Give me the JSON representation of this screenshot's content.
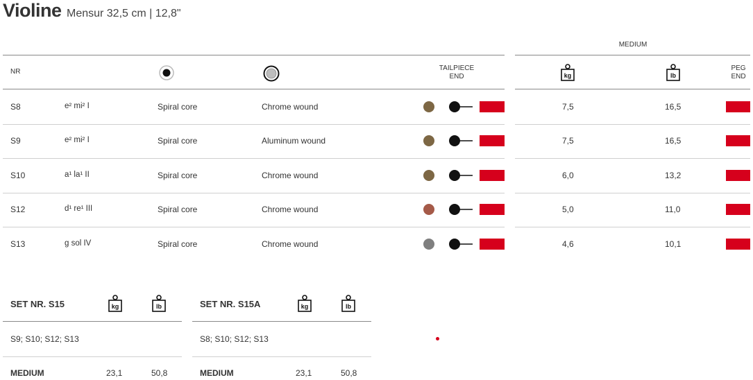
{
  "title": {
    "name": "Violine",
    "subtitle": "Mensur 32,5 cm | 12,8\""
  },
  "table": {
    "col_nr": "NR",
    "col_tailpiece": "TAILPIECE END",
    "col_tension_group": "MEDIUM",
    "col_kg": "kg",
    "col_lb": "lb",
    "col_peg": "PEG END",
    "icons": {
      "core": "core-icon",
      "wrapping": "wrapping-icon",
      "weight": "weight-icon"
    },
    "rows": [
      {
        "nr": "S8",
        "note": "e² mi² I",
        "core": "Spiral core",
        "wound": "Chrome wound",
        "silk": "#7d6744",
        "kg": "7,5",
        "lb": "16,5"
      },
      {
        "nr": "S9",
        "note": "e² mi² I",
        "core": "Spiral core",
        "wound": "Aluminum wound",
        "silk": "#7d6744",
        "kg": "7,5",
        "lb": "16,5"
      },
      {
        "nr": "S10",
        "note": "a¹ la¹ II",
        "core": "Spiral core",
        "wound": "Chrome wound",
        "silk": "#7d6744",
        "kg": "6,0",
        "lb": "13,2"
      },
      {
        "nr": "S12",
        "note": "d¹ re¹ III",
        "core": "Spiral core",
        "wound": "Chrome wound",
        "silk": "#a55a48",
        "kg": "5,0",
        "lb": "11,0"
      },
      {
        "nr": "S13",
        "note": "g sol IV",
        "core": "Spiral core",
        "wound": "Chrome wound",
        "silk": "#7f7f7f",
        "kg": "4,6",
        "lb": "10,1"
      }
    ],
    "end_color": "#d6001c"
  },
  "sets": [
    {
      "title": "SET NR. S15",
      "strings": "S9; S10; S12; S13",
      "tension": "MEDIUM",
      "kg": "23,1",
      "lb": "50,8"
    },
    {
      "title": "SET NR. S15A",
      "strings": "S8; S10; S12; S13",
      "tension": "MEDIUM",
      "kg": "23,1",
      "lb": "50,8"
    }
  ]
}
